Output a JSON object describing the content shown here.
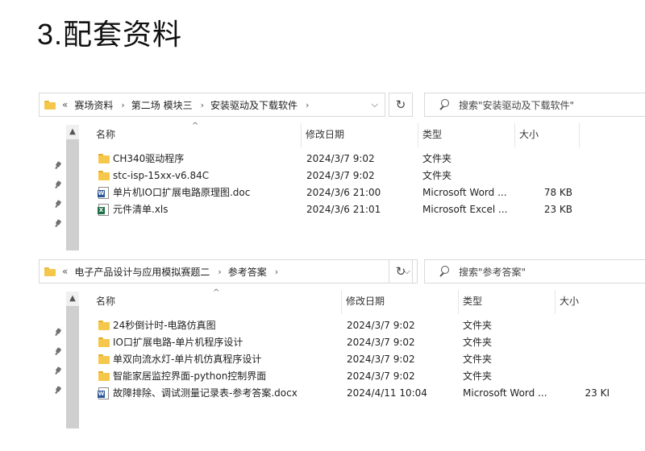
{
  "heading": {
    "number": "3.",
    "text": "配套资料"
  },
  "explorer1": {
    "path": [
      "赛场资料",
      "第二场 模块三",
      "安装驱动及下载软件"
    ],
    "search_placeholder": "搜索\"安装驱动及下载软件\"",
    "columns": {
      "name": "名称",
      "date": "修改日期",
      "type": "类型",
      "size": "大小"
    },
    "files": [
      {
        "icon": "folder-icon",
        "name": "CH340驱动程序",
        "date": "2024/3/7 9:02",
        "type": "文件夹",
        "size": ""
      },
      {
        "icon": "folder-icon",
        "name": "stc-isp-15xx-v6.84C",
        "date": "2024/3/7 9:02",
        "type": "文件夹",
        "size": ""
      },
      {
        "icon": "word-doc-icon",
        "name": "单片机IO口扩展电路原理图.doc",
        "date": "2024/3/6 21:00",
        "type": "Microsoft Word ...",
        "size": "78 KB"
      },
      {
        "icon": "excel-xls-icon",
        "name": "元件清单.xls",
        "date": "2024/3/6 21:01",
        "type": "Microsoft Excel ...",
        "size": "23 KB"
      }
    ]
  },
  "explorer2": {
    "path": [
      "电子产品设计与应用模拟赛题二",
      "参考答案"
    ],
    "search_placeholder": "搜索\"参考答案\"",
    "columns": {
      "name": "名称",
      "date": "修改日期",
      "type": "类型",
      "size": "大小"
    },
    "files": [
      {
        "icon": "folder-icon",
        "name": "24秒倒计时-电路仿真图",
        "date": "2024/3/7 9:02",
        "type": "文件夹",
        "size": ""
      },
      {
        "icon": "folder-icon",
        "name": "IO口扩展电路-单片机程序设计",
        "date": "2024/3/7 9:02",
        "type": "文件夹",
        "size": ""
      },
      {
        "icon": "folder-icon",
        "name": "单双向流水灯-单片机仿真程序设计",
        "date": "2024/3/7 9:02",
        "type": "文件夹",
        "size": ""
      },
      {
        "icon": "folder-icon",
        "name": "智能家居监控界面-python控制界面",
        "date": "2024/3/7 9:02",
        "type": "文件夹",
        "size": ""
      },
      {
        "icon": "word-doc-icon",
        "name": "故障排除、调试测量记录表-参考答案.docx",
        "date": "2024/4/11 10:04",
        "type": "Microsoft Word ...",
        "size": "23 KI"
      }
    ]
  },
  "ui": {
    "back_chevrons": "«",
    "path_sep": "›",
    "dropdown": "⌵",
    "refresh": "↻",
    "scroll_up": "▲",
    "sort_caret": "^"
  }
}
